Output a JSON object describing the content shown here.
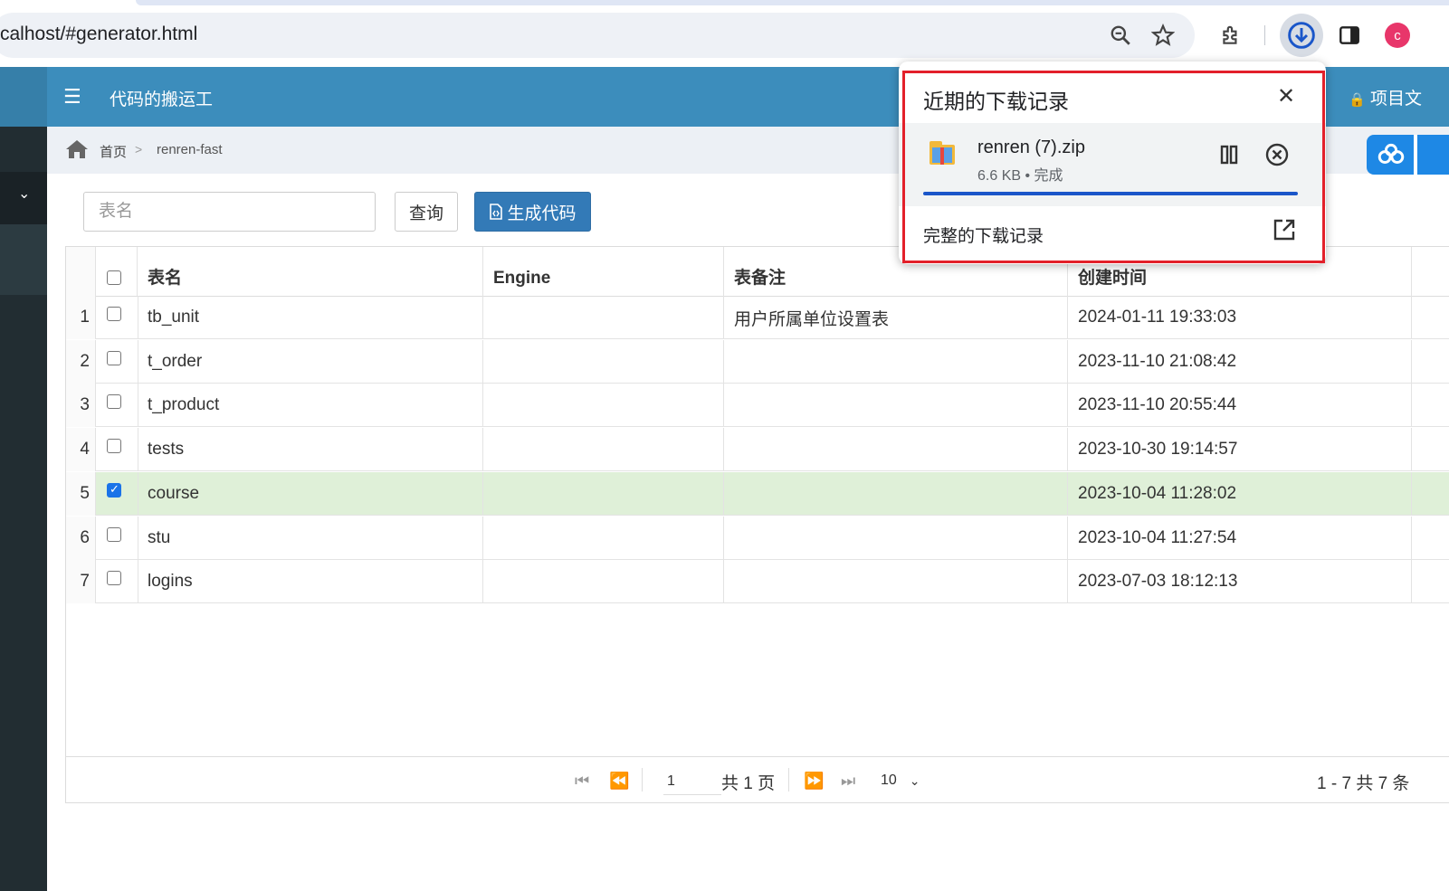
{
  "browser": {
    "url": "calhost/#generator.html",
    "profile_initial": "c"
  },
  "app": {
    "title": "代码的搬运工",
    "project_doc": "项目文",
    "header_color": "#3c8dbc"
  },
  "breadcrumb": {
    "home": "首页",
    "separator": ">",
    "current": "renren-fast"
  },
  "toolbar": {
    "search_placeholder": "表名",
    "query_label": "查询",
    "generate_label": "生成代码"
  },
  "table": {
    "columns": [
      "表名",
      "Engine",
      "表备注",
      "创建时间"
    ],
    "rows": [
      {
        "num": "1",
        "checked": false,
        "name": "tb_unit",
        "engine": "",
        "comment": "用户所属单位设置表",
        "created": "2024-01-11 19:33:03"
      },
      {
        "num": "2",
        "checked": false,
        "name": "t_order",
        "engine": "",
        "comment": "",
        "created": "2023-11-10 21:08:42"
      },
      {
        "num": "3",
        "checked": false,
        "name": "t_product",
        "engine": "",
        "comment": "",
        "created": "2023-11-10 20:55:44"
      },
      {
        "num": "4",
        "checked": false,
        "name": "tests",
        "engine": "",
        "comment": "",
        "created": "2023-10-30 19:14:57"
      },
      {
        "num": "5",
        "checked": true,
        "name": "course",
        "engine": "",
        "comment": "",
        "created": "2023-10-04 11:28:02"
      },
      {
        "num": "6",
        "checked": false,
        "name": "stu",
        "engine": "",
        "comment": "",
        "created": "2023-10-04 11:27:54"
      },
      {
        "num": "7",
        "checked": false,
        "name": "logins",
        "engine": "",
        "comment": "",
        "created": "2023-07-03 18:12:13"
      }
    ]
  },
  "pager": {
    "page_value": "1",
    "total_pages": "共 1 页",
    "page_size": "10",
    "record_info": "1 - 7    共 7 条"
  },
  "downloads": {
    "title": "近期的下载记录",
    "file_name": "renren (7).zip",
    "file_meta": "6.6 KB • 完成",
    "progress": 1.0,
    "full_history": "完整的下载记录",
    "highlight_color": "#e3202a"
  }
}
